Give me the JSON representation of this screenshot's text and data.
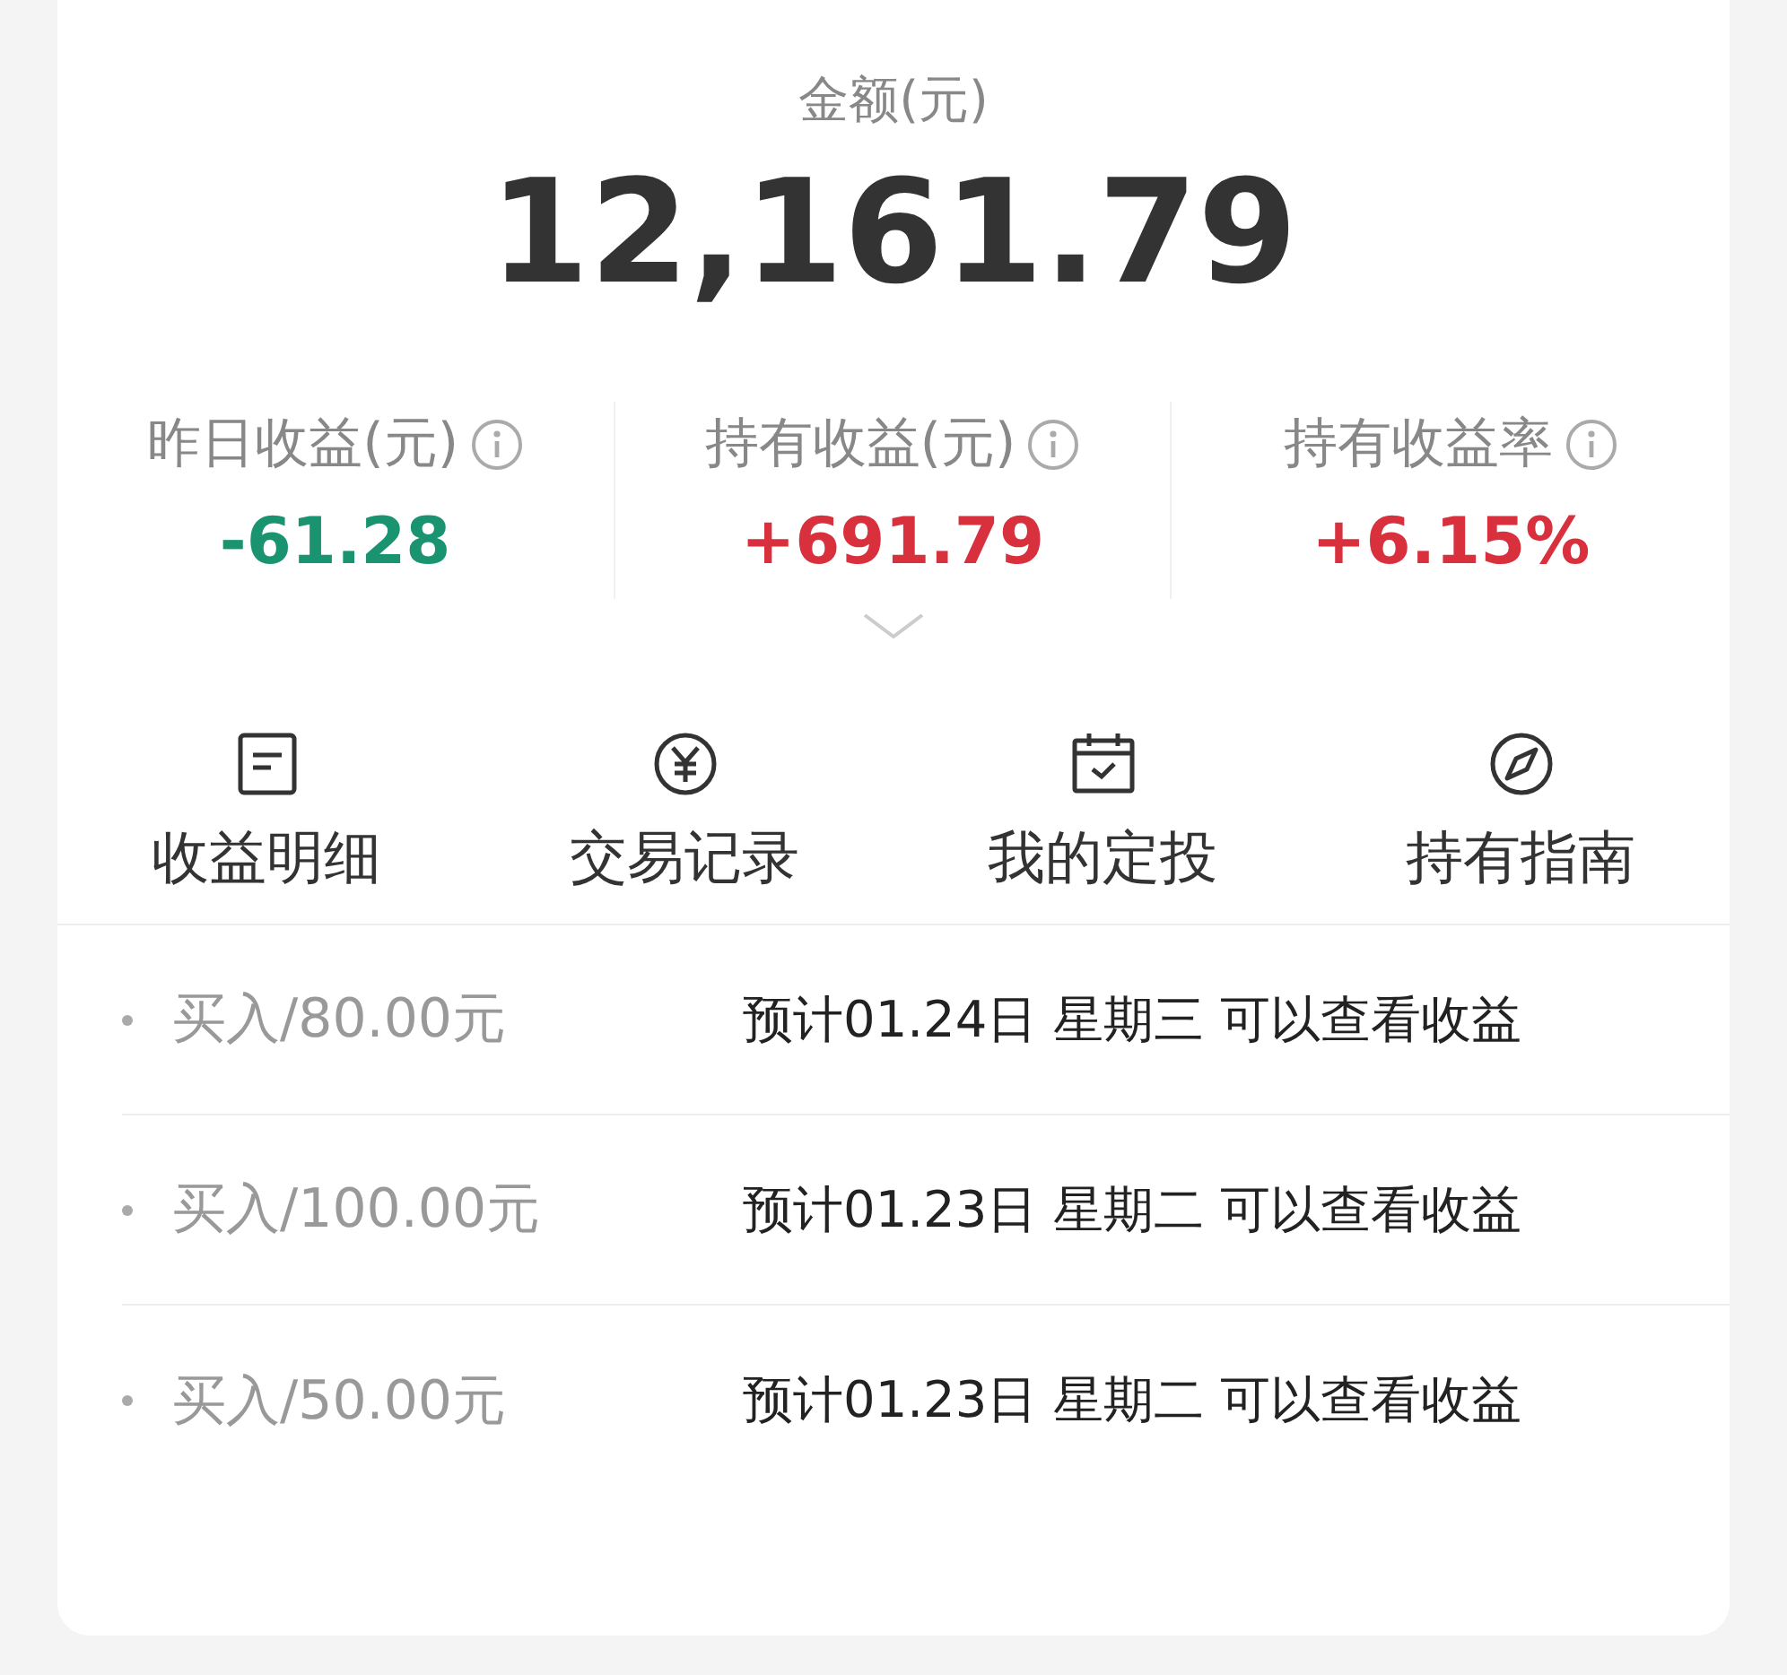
{
  "balance": {
    "label": "金额(元)",
    "amount": "12,161.79"
  },
  "stats": [
    {
      "label": "昨日收益(元)",
      "value": "-61.28",
      "kind": "loss"
    },
    {
      "label": "持有收益(元)",
      "value": "+691.79",
      "kind": "gain"
    },
    {
      "label": "持有收益率",
      "value": "+6.15%",
      "kind": "gain"
    }
  ],
  "shortcuts": [
    {
      "label": "收益明细",
      "kind": "document"
    },
    {
      "label": "交易记录",
      "kind": "yen"
    },
    {
      "label": "我的定投",
      "kind": "calendar"
    },
    {
      "label": "持有指南",
      "kind": "compass"
    }
  ],
  "transactions": [
    {
      "amount": "买入/80.00元",
      "note": "预计01.24日 星期三 可以查看收益"
    },
    {
      "amount": "买入/100.00元",
      "note": "预计01.23日 星期二 可以查看收益"
    },
    {
      "amount": "买入/50.00元",
      "note": "预计01.23日 星期二 可以查看收益"
    }
  ]
}
